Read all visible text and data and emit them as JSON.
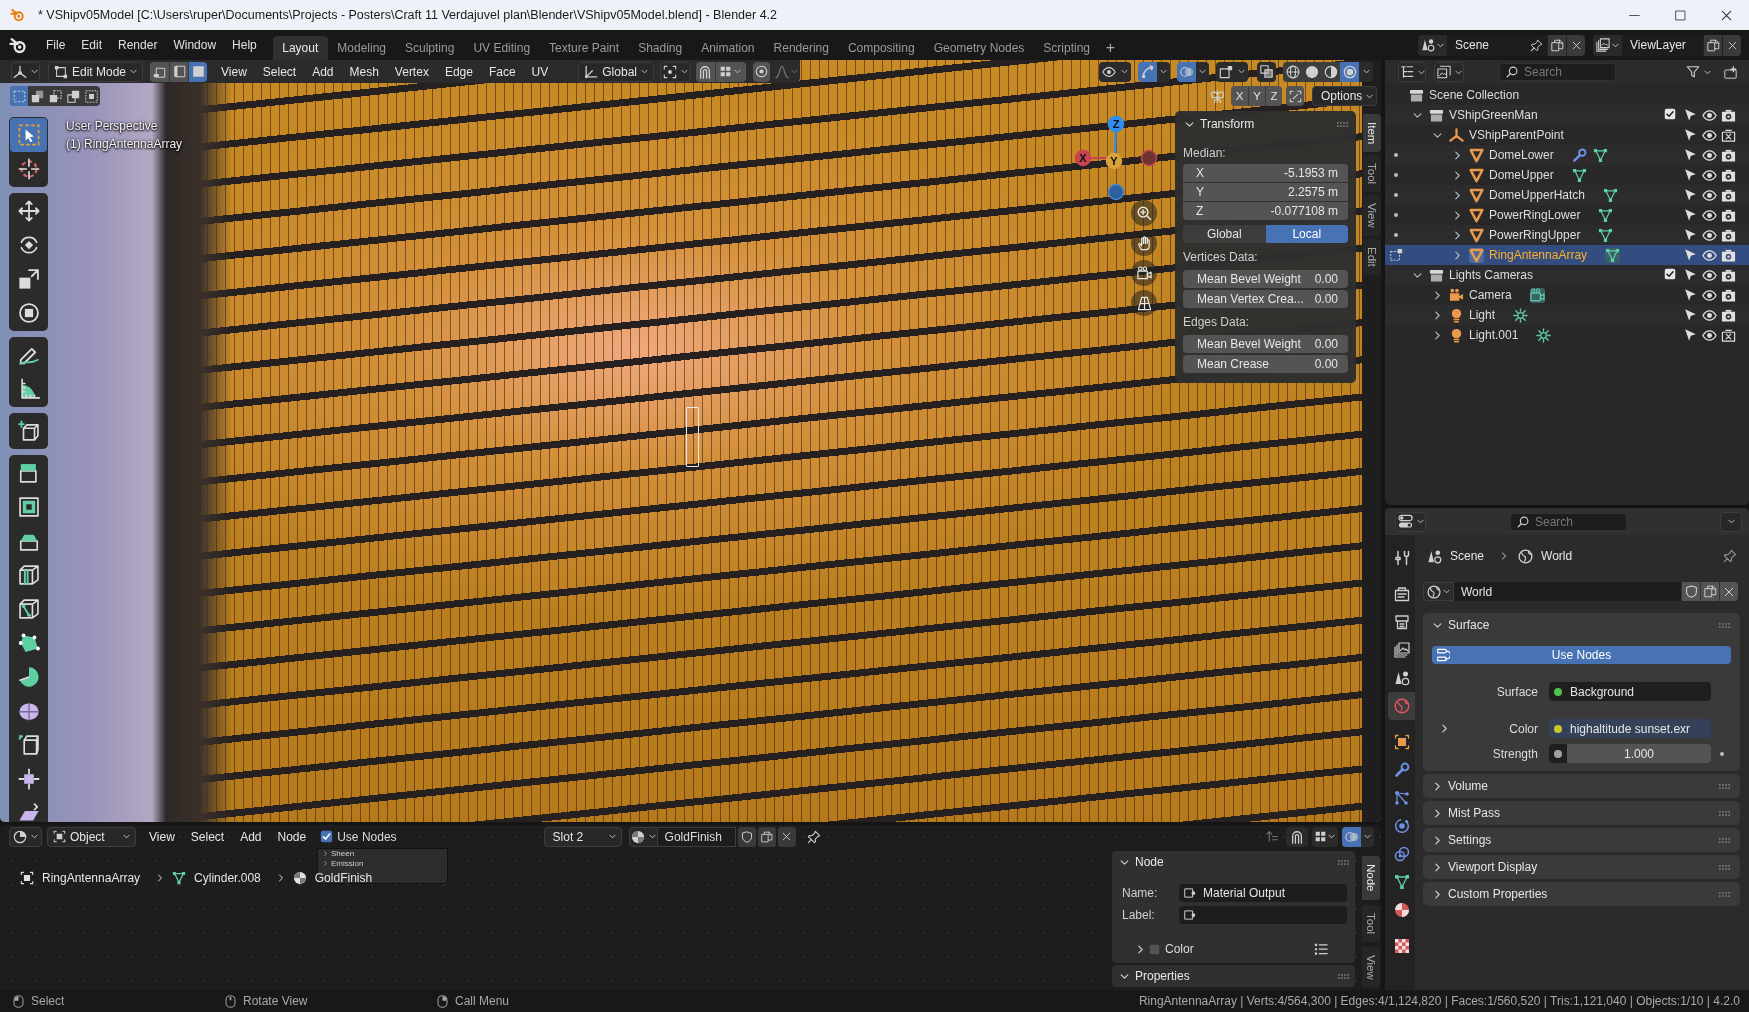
{
  "window": {
    "title": "* VShipv05Model [C:\\Users\\ruper\\Documents\\Projects - Posters\\Craft 11 Verdajuvel plan\\Blender\\VShipv05Model.blend] - Blender 4.2"
  },
  "menu": [
    "File",
    "Edit",
    "Render",
    "Window",
    "Help"
  ],
  "workspaces": [
    {
      "label": "Layout",
      "selected": true
    },
    {
      "label": "Modeling",
      "selected": false
    },
    {
      "label": "Sculpting",
      "selected": false
    },
    {
      "label": "UV Editing",
      "selected": false
    },
    {
      "label": "Texture Paint",
      "selected": false
    },
    {
      "label": "Shading",
      "selected": false
    },
    {
      "label": "Animation",
      "selected": false
    },
    {
      "label": "Rendering",
      "selected": false
    },
    {
      "label": "Compositing",
      "selected": false
    },
    {
      "label": "Geometry Nodes",
      "selected": false
    },
    {
      "label": "Scripting",
      "selected": false
    }
  ],
  "add_workspace": "+",
  "scene": "Scene",
  "view_layer": "ViewLayer",
  "viewport": {
    "mode": "Edit Mode",
    "select_modes": [
      {
        "kind": "vertex",
        "selected": false
      },
      {
        "kind": "edge",
        "selected": false
      },
      {
        "kind": "face",
        "selected": true
      }
    ],
    "menus": [
      "View",
      "Select",
      "Add",
      "Mesh",
      "Vertex",
      "Edge",
      "Face",
      "UV"
    ],
    "orientation": "Global",
    "proportional_editing": false,
    "display_toggles": [
      {
        "kind": "visibility",
        "on": false
      },
      {
        "kind": "gizmo",
        "on": true
      },
      {
        "kind": "overlays",
        "on": true
      },
      {
        "kind": "mesh-overlays",
        "on": false
      }
    ],
    "xray": false,
    "shading": [
      {
        "kind": "wireframe",
        "selected": false
      },
      {
        "kind": "solid",
        "selected": false
      },
      {
        "kind": "material",
        "selected": false
      },
      {
        "kind": "rendered",
        "selected": true
      }
    ],
    "box_select_modes": [
      {
        "kind": "set",
        "selected": true
      },
      {
        "kind": "extend",
        "selected": false
      },
      {
        "kind": "subtract",
        "selected": false
      },
      {
        "kind": "invert",
        "selected": false
      },
      {
        "kind": "intersect",
        "selected": false
      }
    ],
    "mirror_axes": [
      {
        "label": "X",
        "on": false
      },
      {
        "label": "Y",
        "on": false
      },
      {
        "label": "Z",
        "on": false
      }
    ],
    "options": "Options",
    "view_name": "User Perspective",
    "active_object": "(1) RingAntennaArray",
    "toolbar": [
      [
        {
          "kind": "select",
          "selected": true
        },
        {
          "kind": "cursor",
          "selected": false
        }
      ],
      [
        {
          "kind": "move",
          "selected": false
        },
        {
          "kind": "rotate",
          "selected": false
        },
        {
          "kind": "scale",
          "selected": false
        },
        {
          "kind": "transform",
          "selected": false
        }
      ],
      [
        {
          "kind": "annotate",
          "selected": false
        },
        {
          "kind": "measure",
          "selected": false
        }
      ],
      [
        {
          "kind": "add-cube",
          "selected": false
        }
      ],
      [
        {
          "kind": "extrude",
          "selected": false
        },
        {
          "kind": "inset",
          "selected": false
        },
        {
          "kind": "bevel",
          "selected": false
        },
        {
          "kind": "loop-cut",
          "selected": false
        },
        {
          "kind": "knife",
          "selected": false
        },
        {
          "kind": "poly-build",
          "selected": false
        },
        {
          "kind": "spin",
          "selected": false
        },
        {
          "kind": "smooth",
          "selected": false
        },
        {
          "kind": "edge-slide",
          "selected": false
        },
        {
          "kind": "shrink",
          "selected": false
        },
        {
          "kind": "shear",
          "selected": false
        }
      ]
    ],
    "navigation_gizmo": [
      {
        "kind": "neg-x"
      },
      {
        "kind": "neg-z"
      },
      {
        "kind": "z",
        "label": "Z"
      },
      {
        "kind": "x",
        "label": "X"
      },
      {
        "kind": "y",
        "label": "Y"
      }
    ],
    "sidebar": {
      "tabs": [
        {
          "label": "Item",
          "selected": true
        },
        {
          "label": "Tool",
          "selected": false
        },
        {
          "label": "View",
          "selected": false
        },
        {
          "label": "Edit",
          "selected": false
        }
      ],
      "panel": {
        "title": "Transform",
        "expanded": true,
        "median_label": "Median:",
        "median": [
          {
            "axis": "X",
            "value": "-5.1953 m"
          },
          {
            "axis": "Y",
            "value": "2.2575 m"
          },
          {
            "axis": "Z",
            "value": "-0.077108 m"
          }
        ],
        "space": [
          {
            "label": "Global",
            "selected": false
          },
          {
            "label": "Local",
            "selected": true
          }
        ],
        "vertices_label": "Vertices Data:",
        "vertices": [
          {
            "label": "Mean Bevel Weight",
            "value": "0.00"
          },
          {
            "label": "Mean Vertex Crea...",
            "value": "0.00"
          }
        ],
        "edges_label": "Edges Data:",
        "edges": [
          {
            "label": "Mean Bevel Weight",
            "value": "0.00"
          },
          {
            "label": "Mean Crease",
            "value": "0.00"
          }
        ]
      }
    }
  },
  "outliner": {
    "search": {
      "placeholder": "Search"
    },
    "tree": [
      {
        "kind": "scene-collection",
        "label": "Scene Collection",
        "selected": false,
        "children": [
          {
            "kind": "collection",
            "label": "VShipGreenMan",
            "expanded": true,
            "selected": false,
            "checked": true,
            "visible": true,
            "renderable": true,
            "children": [
              {
                "kind": "empty",
                "label": "VShipParentPoint",
                "expanded": true,
                "selected": false,
                "visible": true,
                "renderable": false,
                "children": [
                  {
                    "kind": "mesh",
                    "label": "DomeLower",
                    "expanded": false,
                    "selected": false,
                    "editing": false,
                    "modifiers": true,
                    "data_active": false,
                    "visible": true,
                    "renderable": true
                  },
                  {
                    "kind": "mesh",
                    "label": "DomeUpper",
                    "expanded": false,
                    "selected": false,
                    "editing": false,
                    "modifiers": false,
                    "data_active": false,
                    "visible": true,
                    "renderable": true
                  },
                  {
                    "kind": "mesh",
                    "label": "DomeUpperHatch",
                    "expanded": false,
                    "selected": false,
                    "editing": false,
                    "modifiers": false,
                    "data_active": false,
                    "visible": true,
                    "renderable": true
                  },
                  {
                    "kind": "mesh",
                    "label": "PowerRingLower",
                    "expanded": false,
                    "selected": false,
                    "editing": false,
                    "modifiers": false,
                    "data_active": false,
                    "visible": true,
                    "renderable": true
                  },
                  {
                    "kind": "mesh",
                    "label": "PowerRingUpper",
                    "expanded": false,
                    "selected": false,
                    "editing": false,
                    "modifiers": false,
                    "data_active": false,
                    "visible": true,
                    "renderable": true
                  },
                  {
                    "kind": "mesh",
                    "label": "RingAntennaArray",
                    "expanded": false,
                    "selected": true,
                    "editing": true,
                    "modifiers": false,
                    "data_active": true,
                    "visible": true,
                    "renderable": true
                  }
                ]
              }
            ]
          },
          {
            "kind": "collection",
            "label": "Lights Cameras",
            "expanded": true,
            "selected": false,
            "checked": true,
            "visible": true,
            "renderable": true,
            "children": [
              {
                "kind": "camera",
                "label": "Camera",
                "expanded": false,
                "selected": false,
                "data_active": true,
                "visible": true,
                "renderable": true
              },
              {
                "kind": "light",
                "label": "Light",
                "expanded": false,
                "selected": false,
                "data_active": false,
                "visible": true,
                "renderable": true
              },
              {
                "kind": "light",
                "label": "Light.001",
                "expanded": false,
                "selected": false,
                "data_active": false,
                "visible": true,
                "renderable": false
              }
            ]
          }
        ]
      }
    ]
  },
  "properties": {
    "search": {
      "placeholder": "Search"
    },
    "tabs": [
      [
        {
          "kind": "tool",
          "selected": false
        }
      ],
      [
        {
          "kind": "render",
          "selected": false
        },
        {
          "kind": "output",
          "selected": false
        },
        {
          "kind": "view-layer",
          "selected": false
        },
        {
          "kind": "scene",
          "selected": false
        },
        {
          "kind": "world",
          "selected": true
        }
      ],
      [
        {
          "kind": "object",
          "selected": false
        },
        {
          "kind": "modifiers",
          "selected": false
        },
        {
          "kind": "particles",
          "selected": false
        },
        {
          "kind": "physics",
          "selected": false
        },
        {
          "kind": "constraints",
          "selected": false
        },
        {
          "kind": "data",
          "selected": false
        },
        {
          "kind": "material",
          "selected": false
        }
      ],
      [
        {
          "kind": "texture",
          "selected": false
        }
      ]
    ],
    "breadcrumb": [
      {
        "kind": "scene",
        "label": "Scene"
      },
      {
        "kind": "world",
        "label": "World"
      }
    ],
    "datablock": "World",
    "panels": [
      {
        "title": "Surface",
        "expanded": true,
        "use_nodes": {
          "label": "Use Nodes",
          "on": true
        },
        "fields": [
          {
            "kind": "shader",
            "label": "Surface",
            "value": "Background",
            "color": "#4fc34f"
          },
          {
            "kind": "texture",
            "label": "Color",
            "value": "highaltitude sunset.exr",
            "color": "#c7c72a",
            "expanded": false
          },
          {
            "kind": "number",
            "label": "Strength",
            "value": "1.000",
            "color": "#a0a0a0"
          }
        ]
      },
      {
        "title": "Volume",
        "expanded": false
      },
      {
        "title": "Mist Pass",
        "expanded": false
      },
      {
        "title": "Settings",
        "expanded": false
      },
      {
        "title": "Viewport Display",
        "expanded": false
      },
      {
        "title": "Custom Properties",
        "expanded": false
      }
    ]
  },
  "node_editor": {
    "mode": "Object",
    "menus": [
      "View",
      "Select",
      "Add",
      "Node"
    ],
    "use_nodes": {
      "label": "Use Nodes",
      "checked": true
    },
    "slot": "Slot 2",
    "material": "GoldFinish",
    "overlays": true,
    "breadcrumb": [
      {
        "kind": "object",
        "label": "RingAntennaArray"
      },
      {
        "kind": "mesh",
        "label": "Cylinder.008"
      },
      {
        "kind": "material",
        "label": "GoldFinish"
      }
    ],
    "node": {
      "sockets": [
        {
          "label": "Sheen",
          "expanded": false
        },
        {
          "label": "Emission",
          "expanded": false
        }
      ]
    },
    "sidebar": {
      "tabs": [
        {
          "label": "Node",
          "selected": true
        },
        {
          "label": "Tool",
          "selected": false
        },
        {
          "label": "View",
          "selected": false
        }
      ],
      "node_panel": {
        "title": "Node",
        "expanded": true,
        "name_label": "Name:",
        "name": "Material Output",
        "label_label": "Label:",
        "color": {
          "label": "Color",
          "checked": false,
          "expanded": false
        }
      },
      "properties_panel": {
        "title": "Properties",
        "expanded": true
      }
    }
  },
  "status_bar": {
    "hints": [
      {
        "kind": "left-click",
        "label": "Select"
      },
      {
        "kind": "middle-click",
        "label": "Rotate View"
      },
      {
        "kind": "right-click",
        "label": "Call Menu"
      }
    ],
    "stats": "RingAntennaArray | Verts:4/564,300 | Edges:4/1,124,820 | Faces:1/560,520 | Tris:1,121,040 | Objects:1/10 | 4.2.0"
  }
}
